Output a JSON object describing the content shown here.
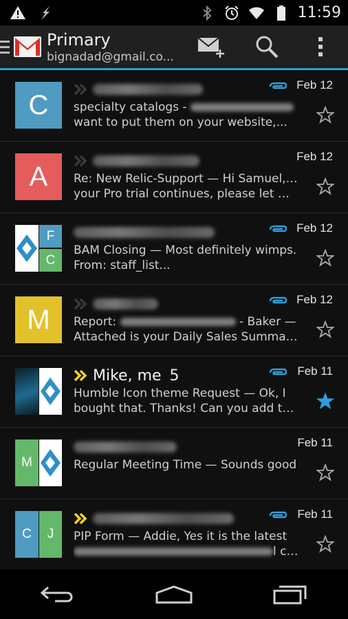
{
  "status_bar": {
    "time": "11:59",
    "left_icons": [
      "warning-icon",
      "lightning-icon"
    ],
    "right_icons": [
      "bluetooth-icon",
      "alarm-icon",
      "wifi-icon",
      "battery-icon"
    ]
  },
  "action_bar": {
    "title": "Primary",
    "account": "bignadad@gmail.co...",
    "buttons": [
      "compose-icon",
      "search-icon",
      "overflow-menu-icon"
    ],
    "accent_color": "#2f9fd8"
  },
  "emails": [
    {
      "avatar_type": "letter",
      "avatar_letter": "C",
      "avatar_color": "#4f9bc2",
      "sender": "",
      "count": "",
      "chevron": "gray",
      "date": "Feb 12",
      "attachment": true,
      "starred": false,
      "line1": "specialty catalogs -",
      "line2": "want to put them on your website,..."
    },
    {
      "avatar_type": "letter",
      "avatar_letter": "A",
      "avatar_color": "#e55c5c",
      "sender": "",
      "count": "",
      "chevron": "gray",
      "date": "Feb 12",
      "attachment": false,
      "starred": false,
      "line1": "Re: New Relic-Support — Hi Samuel, As",
      "line2": "your Pro trial continues, please let me..."
    },
    {
      "avatar_type": "multi",
      "tile_letters": [
        "F",
        "C"
      ],
      "sender": "",
      "count": "",
      "chevron": "none",
      "date": "Feb 12",
      "attachment": true,
      "starred": false,
      "line1": "BAM Closing — Most definitely wimps.",
      "line2": "From: staff_list..."
    },
    {
      "avatar_type": "letter",
      "avatar_letter": "M",
      "avatar_color": "#e2c12b",
      "sender": "",
      "count": "",
      "chevron": "gray",
      "date": "Feb 12",
      "attachment": true,
      "starred": false,
      "line1_a": "Report:",
      "line1_b": "- Baker —",
      "line2": "Attached is your Daily Sales Summary f..."
    },
    {
      "avatar_type": "photo-logo",
      "sender": "Mike, me",
      "count": "5",
      "chevron": "yellow",
      "date": "Feb 11",
      "attachment": true,
      "starred": true,
      "line1": "Humble Icon theme Request — Ok, I",
      "line2": "bought that. Thanks! Can you add these..."
    },
    {
      "avatar_type": "multi2",
      "tile_letters": [
        "M"
      ],
      "sender": "",
      "count": "",
      "chevron": "none",
      "date": "Feb 11",
      "attachment": false,
      "starred": false,
      "line1": "Regular Meeting Time — Sounds good",
      "line2": ""
    },
    {
      "avatar_type": "multi3",
      "tile_letters": [
        "C",
        "J"
      ],
      "sender": "",
      "count": "",
      "chevron": "yellow",
      "date": "Feb 11",
      "attachment": true,
      "starred": false,
      "line1": "PIP Form — Addie, Yes it is the latest",
      "line2_suffix": "l can..."
    }
  ],
  "colors": {
    "star_active": "#2b9fe0",
    "chevron_important": "#f0d21e",
    "tile_blue": "#4f9bc2",
    "tile_green": "#64b86a"
  },
  "nav_bar": [
    "back-icon",
    "home-icon",
    "recents-icon"
  ]
}
